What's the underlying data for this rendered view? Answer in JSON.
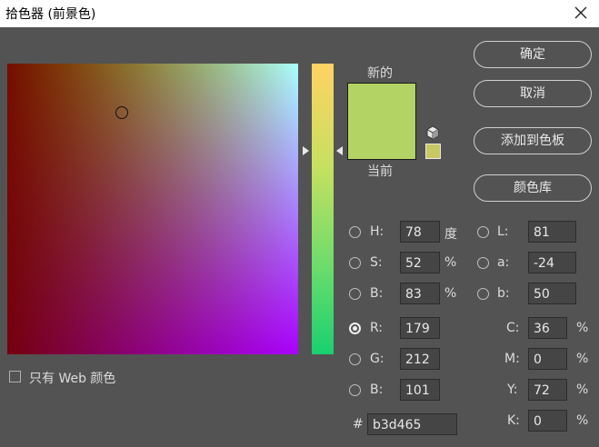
{
  "window": {
    "title": "拾色器 (前景色)"
  },
  "swatches": {
    "new_label": "新的",
    "current_label": "当前",
    "new_color": "#b3d465",
    "current_color": "#b3d465"
  },
  "buttons": {
    "ok": "确定",
    "cancel": "取消",
    "add_to_swatches": "添加到色板",
    "color_libraries": "颜色库"
  },
  "hsb": {
    "h": {
      "label": "H:",
      "value": "78",
      "unit": "度"
    },
    "s": {
      "label": "S:",
      "value": "52",
      "unit": "%"
    },
    "b": {
      "label": "B:",
      "value": "83",
      "unit": "%"
    }
  },
  "rgb": {
    "r": {
      "label": "R:",
      "value": "179"
    },
    "g": {
      "label": "G:",
      "value": "212"
    },
    "b": {
      "label": "B:",
      "value": "101"
    }
  },
  "lab": {
    "l": {
      "label": "L:",
      "value": "81"
    },
    "a": {
      "label": "a:",
      "value": "-24"
    },
    "b": {
      "label": "b:",
      "value": "50"
    }
  },
  "cmyk": {
    "c": {
      "label": "C:",
      "value": "36",
      "unit": "%"
    },
    "m": {
      "label": "M:",
      "value": "0",
      "unit": "%"
    },
    "y": {
      "label": "Y:",
      "value": "72",
      "unit": "%"
    },
    "k": {
      "label": "K:",
      "value": "0",
      "unit": "%"
    }
  },
  "hex": {
    "label": "#",
    "value": "b3d465"
  },
  "web_only": {
    "label": "只有 Web 颜色",
    "checked": false
  },
  "selected_channel": "R"
}
